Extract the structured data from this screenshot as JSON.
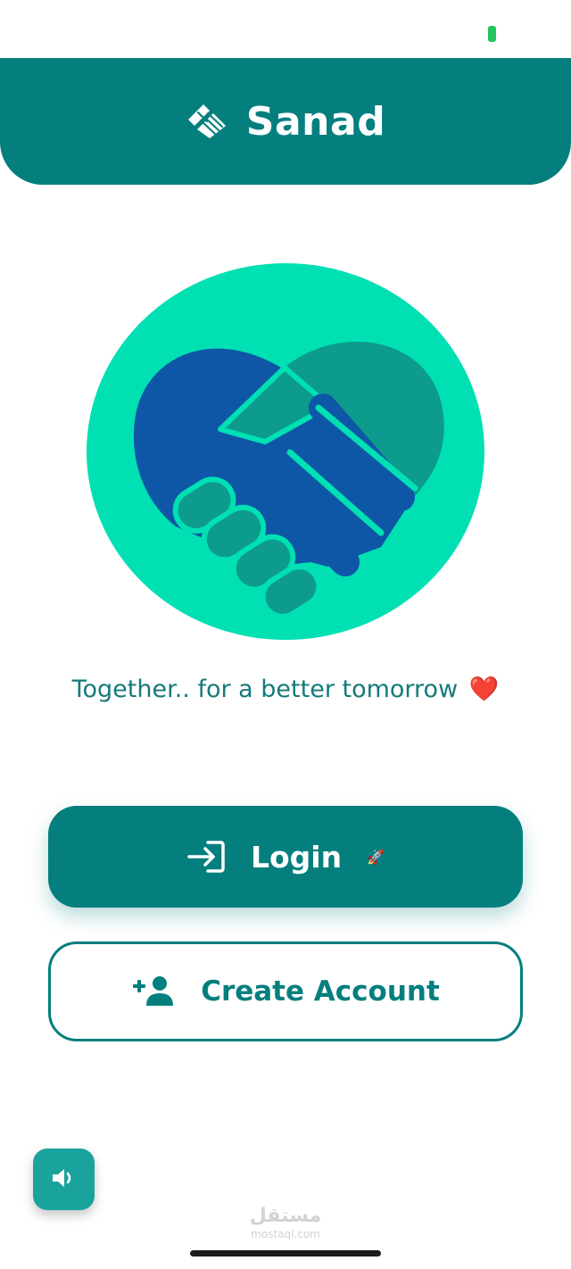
{
  "app": {
    "title": "Sanad",
    "tagline": "Together.. for a better tomorrow",
    "tagline_emoji": "❤️"
  },
  "icons": {
    "brand": "handshake-icon",
    "hero": "handshake-heart-illustration",
    "login": "sign-in-icon",
    "login_emoji": "rocket-emoji",
    "create_account": "add-user-icon",
    "sound": "volume-icon"
  },
  "buttons": {
    "login_label": "Login",
    "login_emoji": "🚀",
    "create_account_label": "Create Account"
  },
  "watermark": {
    "main": "مستقل",
    "sub": "mostaql.com"
  },
  "colors": {
    "primary": "#047f7e",
    "hero_circle": "#00e0b3",
    "hero_blue": "#0e57a6",
    "hero_teal": "#0c9b8c",
    "text_teal": "#157a7a",
    "sound_button": "#1aa39c",
    "battery": "#22c55e"
  }
}
